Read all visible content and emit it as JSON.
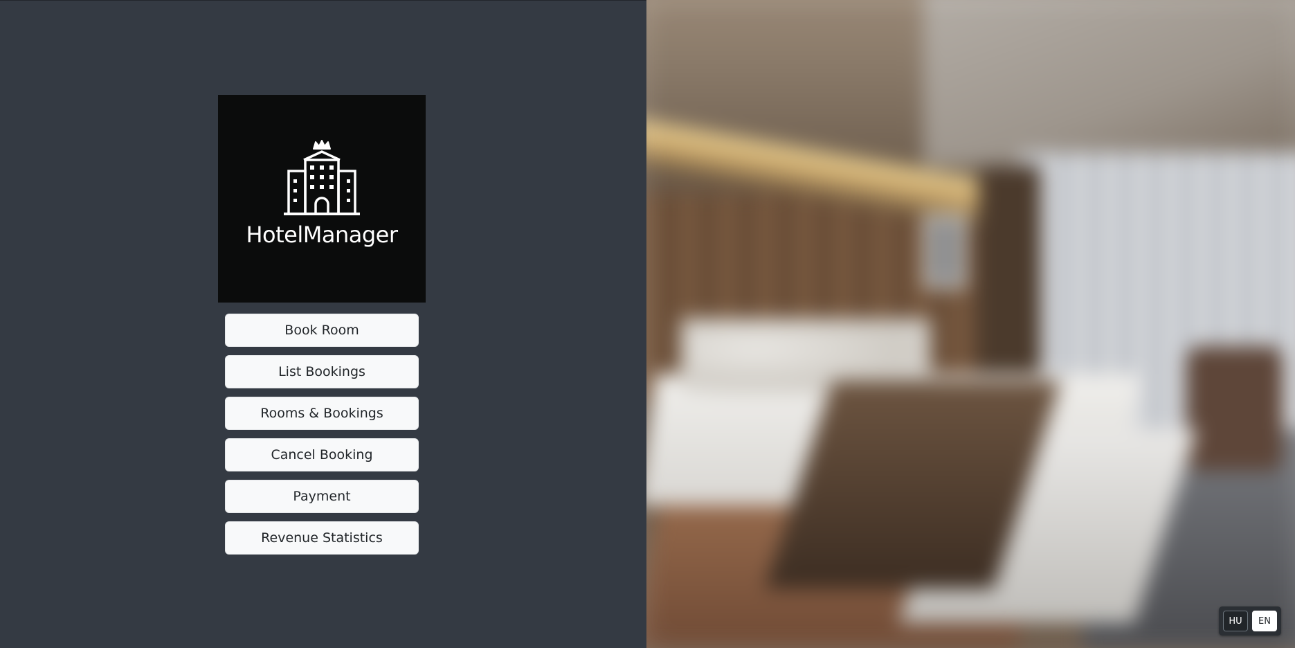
{
  "brand": {
    "name": "HotelManager",
    "icon": "hotel-building-crown-icon"
  },
  "menu": {
    "items": [
      {
        "id": "book-room",
        "label": "Book Room"
      },
      {
        "id": "list-bookings",
        "label": "List Bookings"
      },
      {
        "id": "rooms-bookings",
        "label": "Rooms & Bookings"
      },
      {
        "id": "cancel-booking",
        "label": "Cancel Booking"
      },
      {
        "id": "payment",
        "label": "Payment"
      },
      {
        "id": "revenue-statistics",
        "label": "Revenue Statistics"
      }
    ]
  },
  "language": {
    "options": [
      {
        "code": "HU",
        "active": false
      },
      {
        "code": "EN",
        "active": true
      }
    ]
  },
  "colors": {
    "panel_bg": "#343a43",
    "logo_bg": "#0b0c0c",
    "button_bg": "#f8f9fa",
    "button_text": "#212529"
  }
}
